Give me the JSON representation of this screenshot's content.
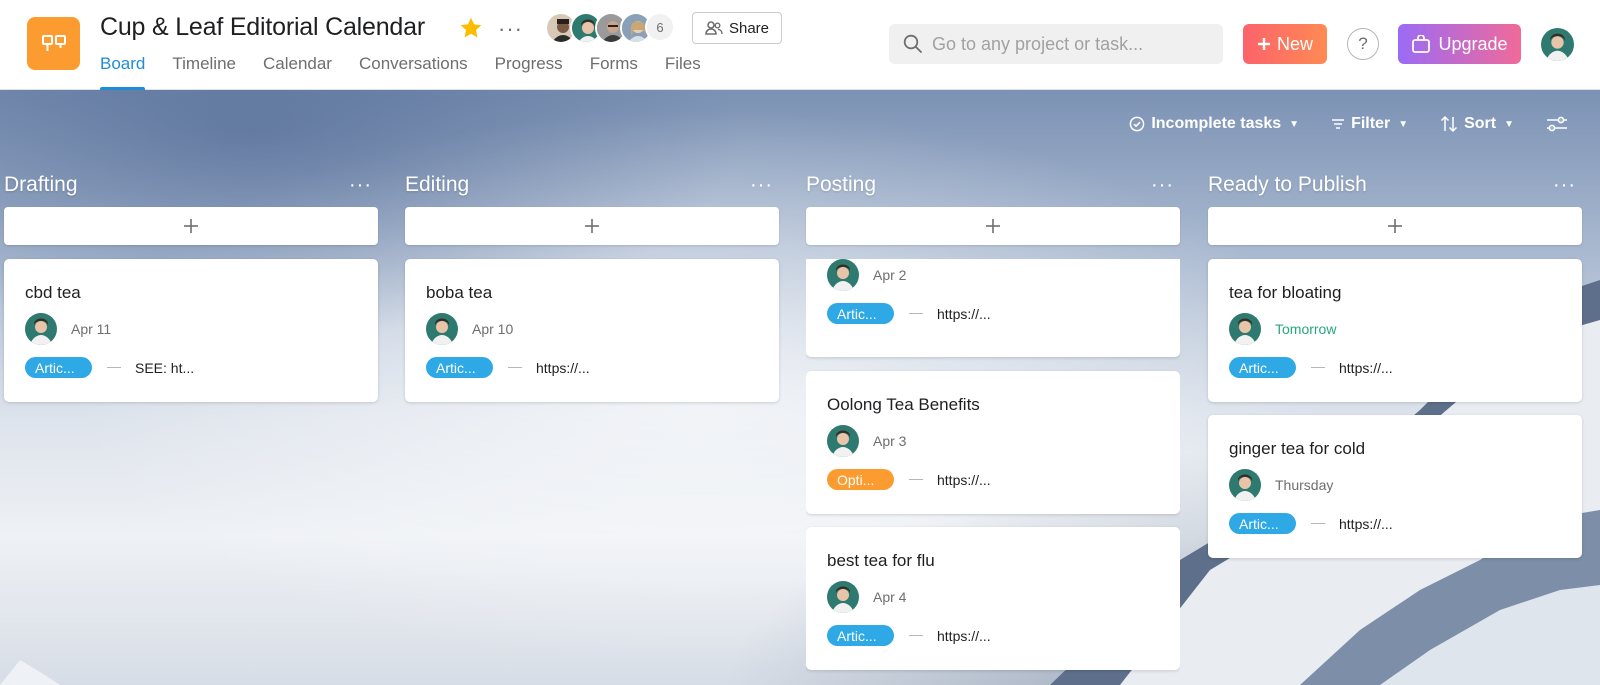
{
  "project": {
    "title": "Cup & Leaf Editorial Calendar",
    "member_count": "6",
    "share_label": "Share"
  },
  "tabs": [
    "Board",
    "Timeline",
    "Calendar",
    "Conversations",
    "Progress",
    "Forms",
    "Files"
  ],
  "search": {
    "placeholder": "Go to any project or task..."
  },
  "buttons": {
    "new_label": "New",
    "help_label": "?",
    "upgrade_label": "Upgrade"
  },
  "toolbar": {
    "filter_tasks": "Incomplete tasks",
    "filter": "Filter",
    "sort": "Sort"
  },
  "colors": {
    "accent": "#1f8dd6",
    "tag_article": "#2ea9e5",
    "tag_option": "#fc9b30",
    "due_soon": "#25a87e"
  },
  "columns": [
    {
      "title": "Drafting",
      "cards": [
        {
          "title": "cbd tea",
          "due": "Apr 11",
          "tag": "Artic...",
          "link": "SEE: ht..."
        }
      ]
    },
    {
      "title": "Editing",
      "cards": [
        {
          "title": "boba tea",
          "due": "Apr 10",
          "tag": "Artic...",
          "link": "https://..."
        }
      ]
    },
    {
      "title": "Posting",
      "cards": [
        {
          "title": "",
          "due": "Apr 2",
          "tag": "Artic...",
          "link": "https://..."
        },
        {
          "title": "Oolong Tea Benefits",
          "due": "Apr 3",
          "tag": "Opti...",
          "link": "https://..."
        },
        {
          "title": "best tea for flu",
          "due": "Apr 4",
          "tag": "Artic...",
          "link": "https://..."
        }
      ]
    },
    {
      "title": "Ready to Publish",
      "cards": [
        {
          "title": "tea for bloating",
          "due": "Tomorrow",
          "tag": "Artic...",
          "link": "https://..."
        },
        {
          "title": "ginger tea for cold",
          "due": "Thursday",
          "tag": "Artic...",
          "link": "https://..."
        }
      ]
    }
  ]
}
